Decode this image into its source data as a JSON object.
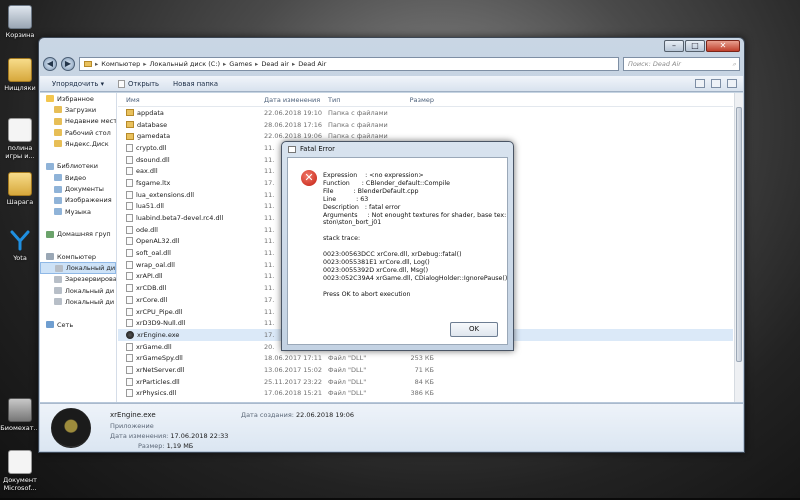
{
  "desktop": {
    "icons": [
      {
        "label": "Корзина",
        "icon": "recycle-bin-icon"
      },
      {
        "label": "Нищляки",
        "icon": "folder-icon"
      },
      {
        "label": "полина игры и...",
        "icon": "document-icon"
      },
      {
        "label": "Шарага",
        "icon": "folder-icon"
      },
      {
        "label": "Yota",
        "icon": "yota-icon"
      },
      {
        "label": "Биомехат...",
        "icon": "app-icon"
      },
      {
        "label": "Документ Microsof...",
        "icon": "document-icon"
      }
    ]
  },
  "explorer": {
    "breadcrumb": [
      "Компьютер",
      "Локальный диск (C:)",
      "Games",
      "Dead air",
      "Dead Air"
    ],
    "search_placeholder": "Поиск: Dead Air",
    "toolbar": {
      "organize": "Упорядочить ▾",
      "open": "Открыть",
      "new_folder": "Новая папка"
    },
    "nav": [
      {
        "label": "Избранное",
        "icon": "star-icon",
        "indent": 0
      },
      {
        "label": "Загрузки",
        "icon": "folder-icon",
        "indent": 1
      },
      {
        "label": "Недавние мест",
        "icon": "folder-icon",
        "indent": 1
      },
      {
        "label": "Рабочий стол",
        "icon": "folder-icon",
        "indent": 1
      },
      {
        "label": "Яндекс.Диск",
        "icon": "folder-icon",
        "indent": 1
      },
      {
        "label": "",
        "icon": "",
        "indent": 0
      },
      {
        "label": "Библиотеки",
        "icon": "library-icon",
        "indent": 0
      },
      {
        "label": "Видео",
        "icon": "library-icon",
        "indent": 1
      },
      {
        "label": "Документы",
        "icon": "library-icon",
        "indent": 1
      },
      {
        "label": "Изображения",
        "icon": "library-icon",
        "indent": 1
      },
      {
        "label": "Музыка",
        "icon": "library-icon",
        "indent": 1
      },
      {
        "label": "",
        "icon": "",
        "indent": 0
      },
      {
        "label": "Домашняя груп",
        "icon": "homegroup-icon",
        "indent": 0
      },
      {
        "label": "",
        "icon": "",
        "indent": 0
      },
      {
        "label": "Компьютер",
        "icon": "computer-icon",
        "indent": 0
      },
      {
        "label": "Локальный ди",
        "icon": "drive-icon",
        "indent": 1,
        "selected": true
      },
      {
        "label": "Зарезервирован",
        "icon": "drive-icon",
        "indent": 1
      },
      {
        "label": "Локальный ди",
        "icon": "drive-icon",
        "indent": 1
      },
      {
        "label": "Локальный ди",
        "icon": "drive-icon",
        "indent": 1
      },
      {
        "label": "",
        "icon": "",
        "indent": 0
      },
      {
        "label": "Сеть",
        "icon": "network-icon",
        "indent": 0
      }
    ],
    "columns": {
      "name": "Имя",
      "date": "Дата изменения",
      "type": "Тип",
      "size": "Размер"
    },
    "files": [
      {
        "name": "appdata",
        "date": "22.06.2018 19:10",
        "type": "Папка с файлами",
        "size": "",
        "kind": "folder"
      },
      {
        "name": "database",
        "date": "28.06.2018 17:16",
        "type": "Папка с файлами",
        "size": "",
        "kind": "folder"
      },
      {
        "name": "gamedata",
        "date": "22.06.2018 19:06",
        "type": "Папка с файлами",
        "size": "",
        "kind": "folder"
      },
      {
        "name": "crypto.dll",
        "date": "11.",
        "type": "",
        "size": "",
        "kind": "file"
      },
      {
        "name": "dsound.dll",
        "date": "11.",
        "type": "",
        "size": "",
        "kind": "file"
      },
      {
        "name": "eax.dll",
        "date": "11.",
        "type": "",
        "size": "",
        "kind": "file"
      },
      {
        "name": "fsgame.ltx",
        "date": "17.",
        "type": "",
        "size": "",
        "kind": "file"
      },
      {
        "name": "lua_extensions.dll",
        "date": "11.",
        "type": "",
        "size": "",
        "kind": "file"
      },
      {
        "name": "lua51.dll",
        "date": "11.",
        "type": "",
        "size": "",
        "kind": "file"
      },
      {
        "name": "luabind.beta7-devel.rc4.dll",
        "date": "11.",
        "type": "",
        "size": "",
        "kind": "file"
      },
      {
        "name": "ode.dll",
        "date": "11.",
        "type": "",
        "size": "",
        "kind": "file"
      },
      {
        "name": "OpenAL32.dll",
        "date": "11.",
        "type": "",
        "size": "",
        "kind": "file"
      },
      {
        "name": "soft_oal.dll",
        "date": "11.",
        "type": "",
        "size": "",
        "kind": "file"
      },
      {
        "name": "wrap_oal.dll",
        "date": "11.",
        "type": "",
        "size": "",
        "kind": "file"
      },
      {
        "name": "xrAPI.dll",
        "date": "11.",
        "type": "",
        "size": "",
        "kind": "file"
      },
      {
        "name": "xrCDB.dll",
        "date": "11.",
        "type": "",
        "size": "",
        "kind": "file"
      },
      {
        "name": "xrCore.dll",
        "date": "17.",
        "type": "",
        "size": "",
        "kind": "file"
      },
      {
        "name": "xrCPU_Pipe.dll",
        "date": "11.",
        "type": "",
        "size": "",
        "kind": "file"
      },
      {
        "name": "xrD3D9-Null.dll",
        "date": "11.",
        "type": "",
        "size": "",
        "kind": "file"
      },
      {
        "name": "xrEngine.exe",
        "date": "17.",
        "type": "",
        "size": "",
        "kind": "exe",
        "selected": true
      },
      {
        "name": "xrGame.dll",
        "date": "20.",
        "type": "",
        "size": "",
        "kind": "file"
      },
      {
        "name": "xrGameSpy.dll",
        "date": "18.06.2017 17:11",
        "type": "Файл \"DLL\"",
        "size": "253 КБ",
        "kind": "file"
      },
      {
        "name": "xrNetServer.dll",
        "date": "13.06.2017 15:02",
        "type": "Файл \"DLL\"",
        "size": "71 КБ",
        "kind": "file"
      },
      {
        "name": "xrParticles.dll",
        "date": "25.11.2017 23:22",
        "type": "Файл \"DLL\"",
        "size": "84 КБ",
        "kind": "file"
      },
      {
        "name": "xrPhysics.dll",
        "date": "17.06.2018 15:21",
        "type": "Файл \"DLL\"",
        "size": "386 КБ",
        "kind": "file"
      }
    ],
    "details": {
      "name": "xrEngine.exe",
      "type": "Приложение",
      "modified_label": "Дата изменения:",
      "modified": "17.06.2018 22:33",
      "size_label": "Размер:",
      "size": "1,19 МБ",
      "created_label": "Дата создания:",
      "created": "22.06.2018 19:06"
    }
  },
  "dialog": {
    "title": "Fatal Error",
    "message": "Expression    : <no expression>\nFunction      : CBlender_default::Compile\nFile          : BlenderDefault.cpp\nLine          : 63\nDescription   : fatal error\nArguments     : Not enought textures for shader, base tex:\nston\\ston_bort_j01\n\nstack trace:\n\n0023:00563DCC xrCore.dll, xrDebug::fatal()\n0023:0055381E1 xrCore.dll, Log()\n0023:0055392D xrCore.dll, Msg()\n0023:052C39A4 xrGame.dll, CDialogHolder::IgnorePause()\n\nPress OK to abort execution",
    "ok_label": "OK"
  }
}
